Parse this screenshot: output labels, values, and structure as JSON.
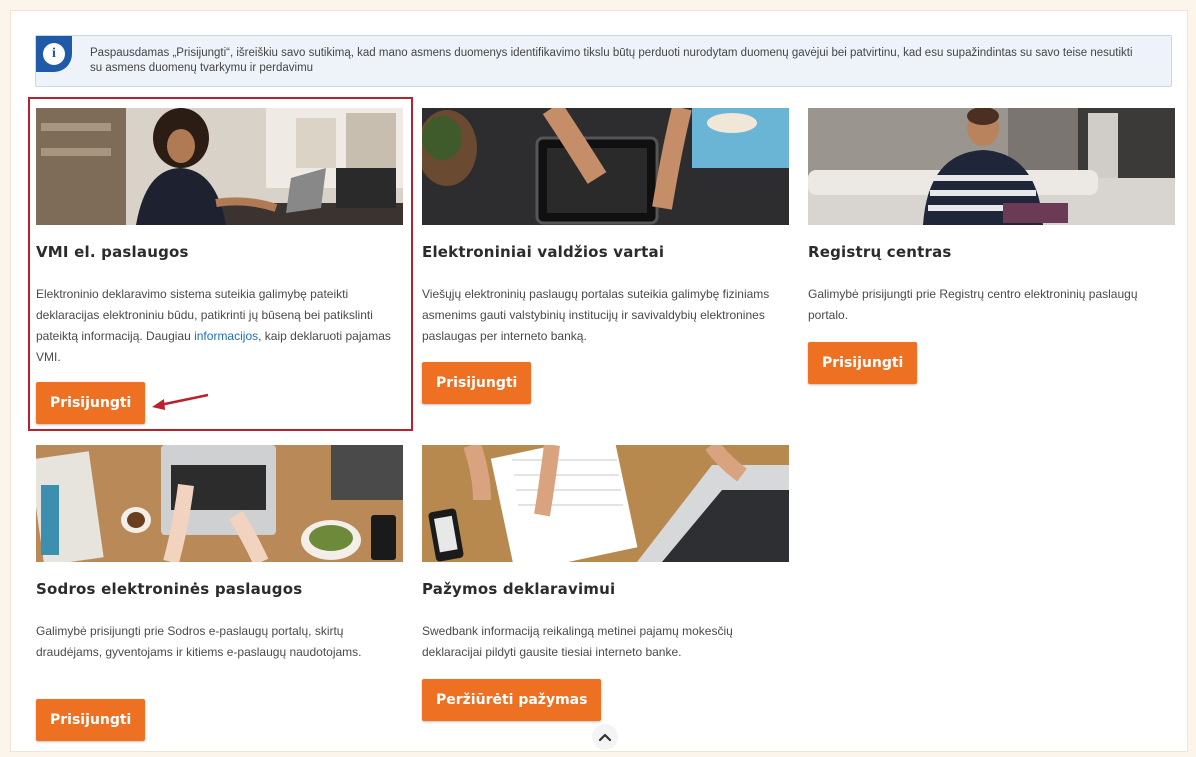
{
  "notice": {
    "icon": "info-icon",
    "text": "Paspausdamas „Prisijungti“, išreiškiu savo sutikimą, kad mano asmens duomenys identifikavimo tikslu būtų perduoti nurodytam duomenų gavėjui bei patvirtinu, kad esu supažindintas su savo teise nesutikti su asmens duomenų tvarkymu ir perdavimu"
  },
  "cards": [
    {
      "title": "VMI el. paslaugos",
      "desc_before": "Elektroninio deklaravimo sistema suteikia galimybę pateikti deklaracijas elektroniniu būdu, patikrinti jų būseną bei patikslinti pateiktą informaciją. Daugiau ",
      "link": "informacijos",
      "desc_after": ", kaip deklaruoti pajamas VMI.",
      "button": "Prisijungti"
    },
    {
      "title": "Elektroniniai valdžios vartai",
      "desc": "Viešųjų elektroninių paslaugų portalas suteikia galimybę fiziniams asmenims gauti valstybinių institucijų ir savivaldybių elektronines paslaugas per interneto banką.",
      "button": "Prisijungti"
    },
    {
      "title": "Registrų centras",
      "desc": "Galimybė prisijungti prie Registrų centro elektroninių paslaugų portalo.",
      "button": "Prisijungti"
    },
    {
      "title": "Sodros elektroninės paslaugos",
      "desc": "Galimybė prisijungti prie Sodros e-paslaugų portalų, skirtų draudėjams, gyventojams ir kitiems e-paslaugų naudotojams.",
      "button": "Prisijungti"
    },
    {
      "title": "Pažymos deklaravimui",
      "desc": "Swedbank informaciją reikalingą metinei pajamų mokesčių deklaracijai pildyti gausite tiesiai interneto banke.",
      "button": "Peržiūrėti pažymas"
    }
  ],
  "colors": {
    "accent": "#ee7023",
    "highlight": "#b8212d",
    "notice_bg": "#eef3fa",
    "info": "#1f5aa8"
  },
  "scroll_top_icon": "chevron-up-icon"
}
